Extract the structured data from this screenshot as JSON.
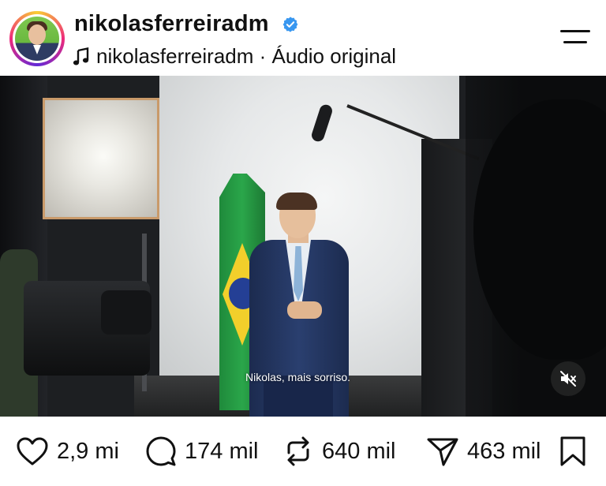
{
  "header": {
    "username": "nikolasferreiradm",
    "audio_label": "nikolasferreiradm · Áudio original",
    "verified_icon": "verified-badge-icon",
    "menu_icon": "hamburger-menu-icon"
  },
  "video": {
    "caption": "Nikolas, mais sorriso.",
    "mute_icon": "muted-speaker-icon"
  },
  "actions": {
    "likes": "2,9 mi",
    "comments": "174 mil",
    "reposts": "640 mil",
    "shares": "463 mil",
    "icons": [
      "heart-icon",
      "comment-icon",
      "repost-icon",
      "share-icon",
      "bookmark-icon"
    ]
  },
  "colors": {
    "verified_blue": "#3897f0",
    "text": "#111111",
    "story_ring": [
      "#f9ce34",
      "#ee2a7b",
      "#6228d7"
    ]
  }
}
